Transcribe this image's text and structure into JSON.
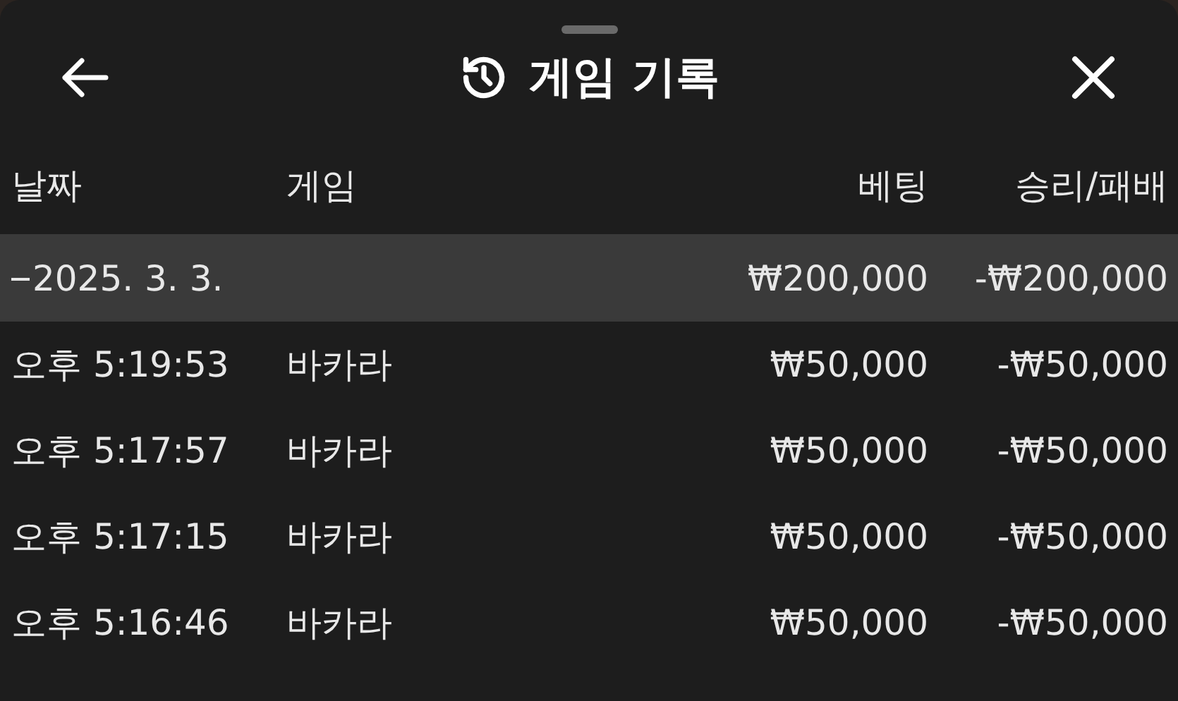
{
  "header": {
    "title": "게임 기록"
  },
  "table": {
    "columns": [
      "날짜",
      "게임",
      "베팅",
      "승리/패배"
    ],
    "groups": [
      {
        "date": "2025. 3. 3.",
        "expanded": true,
        "bet": "₩200,000",
        "result": "-₩200,000",
        "rows": [
          {
            "time": "오후 5:19:53",
            "game": "바카라",
            "bet": "₩50,000",
            "result": "-₩50,000"
          },
          {
            "time": "오후 5:17:57",
            "game": "바카라",
            "bet": "₩50,000",
            "result": "-₩50,000"
          },
          {
            "time": "오후 5:17:15",
            "game": "바카라",
            "bet": "₩50,000",
            "result": "-₩50,000"
          },
          {
            "time": "오후 5:16:46",
            "game": "바카라",
            "bet": "₩50,000",
            "result": "-₩50,000"
          }
        ]
      }
    ]
  }
}
